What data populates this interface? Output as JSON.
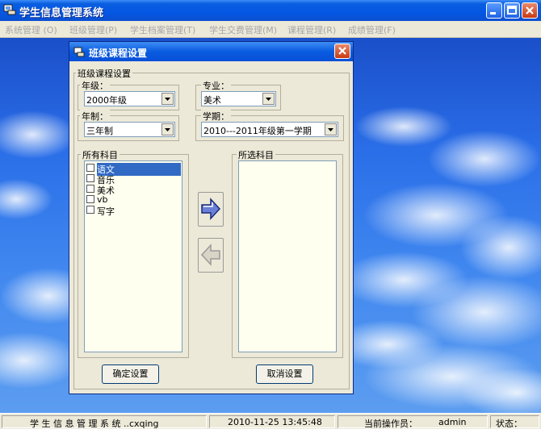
{
  "app": {
    "title": "学生信息管理系统"
  },
  "menu": [
    {
      "label": "系统管理 (O)"
    },
    {
      "label": "班级管理(P)"
    },
    {
      "label": "学生档案管理(T)"
    },
    {
      "label": "学生交费管理(M)"
    },
    {
      "label": "课程管理(R)"
    },
    {
      "label": "成绩管理(F)"
    }
  ],
  "dialog": {
    "title": "班级课程设置",
    "group_title": "班级课程设置",
    "grade": {
      "label": "年级：",
      "value": "2000年级"
    },
    "major": {
      "label": "专业：",
      "value": "美术"
    },
    "system": {
      "label": "年制：",
      "value": "三年制"
    },
    "term": {
      "label": "学期：",
      "value": "2010---2011年级第一学期"
    },
    "all_subjects": {
      "label": "所有科目",
      "items": [
        {
          "text": "语文",
          "checked": false,
          "selected": true
        },
        {
          "text": "音乐",
          "checked": false,
          "selected": false
        },
        {
          "text": "美术",
          "checked": false,
          "selected": false
        },
        {
          "text": "vb",
          "checked": false,
          "selected": false
        },
        {
          "text": "写字",
          "checked": false,
          "selected": false
        }
      ]
    },
    "selected_subjects": {
      "label": "所选科目",
      "items": []
    },
    "confirm_label": "确定设置",
    "cancel_label": "取消设置"
  },
  "statusbar": {
    "app_name": "学 生 信 息 管 理 系 统 ..cxqing",
    "datetime": "2010-11-25 13:45:48",
    "operator_label": "当前操作员：",
    "operator": "admin",
    "state_label": "状态："
  },
  "colors": {
    "titlebar": "#0457e3",
    "selection": "#316ac5",
    "listbox_bg": "#fffff0",
    "sky": "#2a6ee8"
  }
}
